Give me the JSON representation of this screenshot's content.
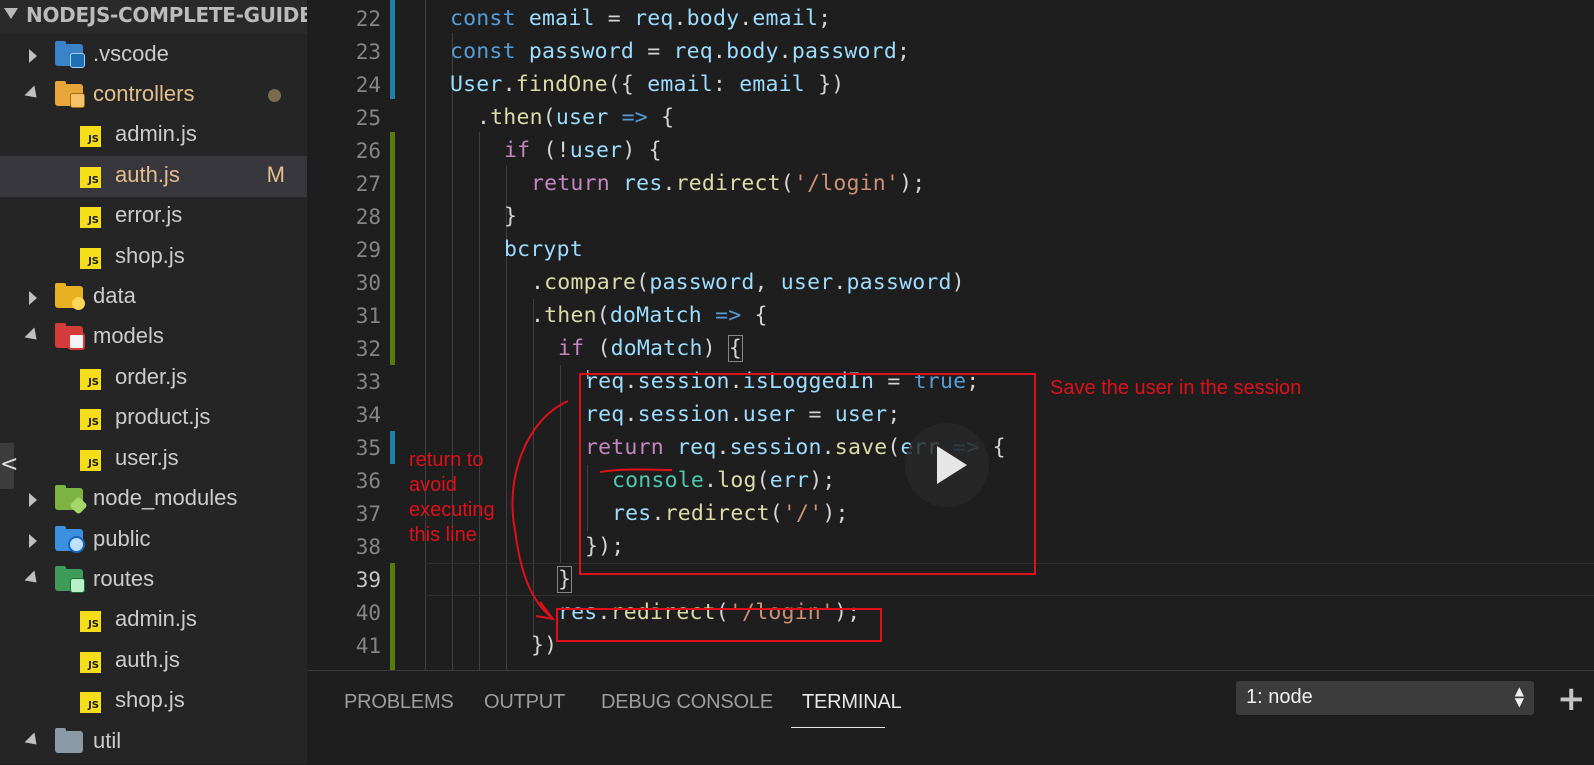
{
  "explorer": {
    "project_name": "NODEJS-COMPLETE-GUIDE",
    "items": [
      {
        "label": ".vscode",
        "kind": "folder",
        "state": "collapsed",
        "icon": "vscode-folder-icon"
      },
      {
        "label": "controllers",
        "kind": "folder",
        "state": "expanded",
        "icon": "controllers-folder-icon",
        "modified_dot": true
      },
      {
        "label": "admin.js",
        "kind": "file",
        "icon": "js-file-icon"
      },
      {
        "label": "auth.js",
        "kind": "file",
        "icon": "js-file-icon",
        "badge": "M",
        "active": true
      },
      {
        "label": "error.js",
        "kind": "file",
        "icon": "js-file-icon"
      },
      {
        "label": "shop.js",
        "kind": "file",
        "icon": "js-file-icon"
      },
      {
        "label": "data",
        "kind": "folder",
        "state": "collapsed",
        "icon": "data-folder-icon"
      },
      {
        "label": "models",
        "kind": "folder",
        "state": "expanded",
        "icon": "models-folder-icon"
      },
      {
        "label": "order.js",
        "kind": "file",
        "icon": "js-file-icon"
      },
      {
        "label": "product.js",
        "kind": "file",
        "icon": "js-file-icon"
      },
      {
        "label": "user.js",
        "kind": "file",
        "icon": "js-file-icon"
      },
      {
        "label": "node_modules",
        "kind": "folder",
        "state": "collapsed",
        "icon": "node-modules-folder-icon"
      },
      {
        "label": "public",
        "kind": "folder",
        "state": "collapsed",
        "icon": "public-folder-icon"
      },
      {
        "label": "routes",
        "kind": "folder",
        "state": "expanded",
        "icon": "routes-folder-icon"
      },
      {
        "label": "admin.js",
        "kind": "file",
        "icon": "js-file-icon"
      },
      {
        "label": "auth.js",
        "kind": "file",
        "icon": "js-file-icon"
      },
      {
        "label": "shop.js",
        "kind": "file",
        "icon": "js-file-icon"
      },
      {
        "label": "util",
        "kind": "folder",
        "state": "expanded",
        "icon": "util-folder-icon"
      }
    ],
    "js_icon_text": "JS",
    "collapse_glyph": "<"
  },
  "editor": {
    "current_line": 39,
    "lines": [
      {
        "n": "22",
        "text": "const email = req.body.email;"
      },
      {
        "n": "23",
        "text": "const password = req.body.password;"
      },
      {
        "n": "24",
        "text": "User.findOne({ email: email })"
      },
      {
        "n": "25",
        "text": ".then(user => {"
      },
      {
        "n": "26",
        "text": "if (!user) {"
      },
      {
        "n": "27",
        "text": "return res.redirect('/login');"
      },
      {
        "n": "28",
        "text": "}"
      },
      {
        "n": "29",
        "text": "bcrypt"
      },
      {
        "n": "30",
        "text": ".compare(password, user.password)"
      },
      {
        "n": "31",
        "text": ".then(doMatch => {"
      },
      {
        "n": "32",
        "text": "if (doMatch) {"
      },
      {
        "n": "33",
        "text": "req.session.isLoggedIn = true;"
      },
      {
        "n": "34",
        "text": "req.session.user = user;"
      },
      {
        "n": "35",
        "text": "return req.session.save(err => {"
      },
      {
        "n": "36",
        "text": "console.log(err);"
      },
      {
        "n": "37",
        "text": "res.redirect('/');"
      },
      {
        "n": "38",
        "text": "});"
      },
      {
        "n": "39",
        "text": "}"
      },
      {
        "n": "40",
        "text": "res.redirect('/login');"
      },
      {
        "n": "41",
        "text": "})"
      }
    ]
  },
  "annotations": {
    "session_note": "Save the user in the session",
    "return_note": [
      "return to",
      "avoid",
      "executing",
      "this line"
    ],
    "color": "#e0101a"
  },
  "panel": {
    "tabs": [
      "PROBLEMS",
      "OUTPUT",
      "DEBUG CONSOLE",
      "TERMINAL"
    ],
    "active_tab": "TERMINAL",
    "terminal_select": "1: node",
    "add_glyph": "+"
  },
  "colors": {
    "sidebar_bg": "#252526",
    "editor_bg": "#1e1e1e",
    "active_row_bg": "#37373d",
    "folder_highlight": "#e2c08d",
    "modified_bar": "#1b81a8",
    "added_bar": "#587c0c"
  }
}
